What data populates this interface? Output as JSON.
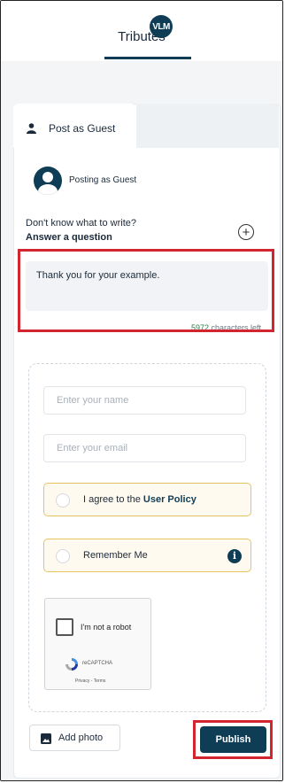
{
  "header": {
    "title": "Tributes"
  },
  "tabs": {
    "guest_label": "Post as Guest",
    "vlm_initials": "VLM"
  },
  "posting": {
    "label": "Posting as Guest"
  },
  "prompt": {
    "line1": "Don't know what to write?",
    "line2": "Answer a question"
  },
  "message": {
    "value": "Thank you for your example.",
    "chars_left_num": "5972",
    "chars_left_suffix": " characters left"
  },
  "form": {
    "name_placeholder": "Enter your name",
    "email_placeholder": "Enter your email",
    "agree_prefix": "I agree to the ",
    "agree_link": "User Policy",
    "remember_label": "Remember Me"
  },
  "recaptcha": {
    "label": "I'm not a robot",
    "brand": "reCAPTCHA",
    "links": "Privacy - Terms"
  },
  "actions": {
    "add_photo": "Add photo",
    "publish": "Publish"
  },
  "colors": {
    "primary": "#0f3d55",
    "highlight": "#d32530",
    "check_border": "#e6c460"
  }
}
